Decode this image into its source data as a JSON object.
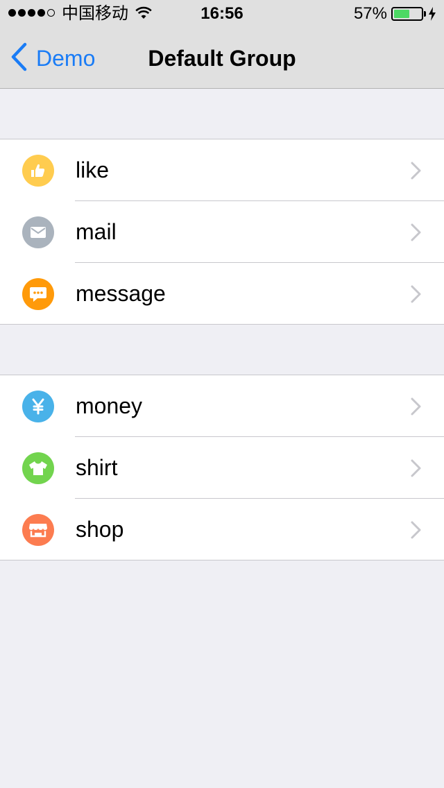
{
  "status_bar": {
    "carrier": "中国移动",
    "time": "16:56",
    "battery_percent": "57%",
    "battery_level": 0.57,
    "signal_bars_filled": 4,
    "signal_bars_total": 5
  },
  "nav": {
    "back_label": "Demo",
    "title": "Default Group"
  },
  "groups": [
    {
      "items": [
        {
          "label": "like",
          "icon": "thumbs-up-icon",
          "color": "#ffcc4f"
        },
        {
          "label": "mail",
          "icon": "envelope-icon",
          "color": "#aab3bd"
        },
        {
          "label": "message",
          "icon": "chat-bubble-icon",
          "color": "#ff9a0a"
        }
      ]
    },
    {
      "items": [
        {
          "label": "money",
          "icon": "yen-icon",
          "color": "#49b2e9"
        },
        {
          "label": "shirt",
          "icon": "tshirt-icon",
          "color": "#72d44e"
        },
        {
          "label": "shop",
          "icon": "storefront-icon",
          "color": "#fc7c50"
        }
      ]
    }
  ],
  "colors": {
    "accent": "#1a7cf6",
    "battery_fill": "#4cd964",
    "background": "#efeff4",
    "navbar": "#e0e0e0"
  }
}
